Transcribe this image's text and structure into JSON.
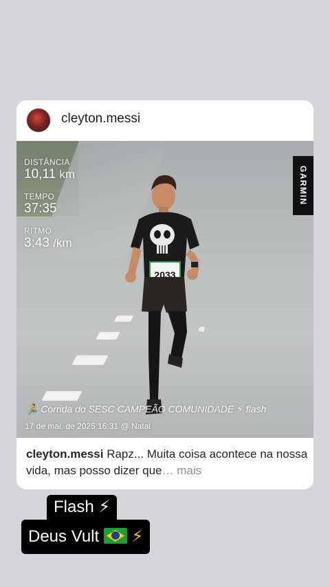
{
  "post": {
    "username": "cleyton.messi",
    "photo": {
      "stats": [
        {
          "label": "DISTÂNCIA",
          "value": "10,11",
          "unit": "km"
        },
        {
          "label": "TEMPO",
          "value": "37:35",
          "unit": ""
        },
        {
          "label": "RITMO",
          "value": "3:43",
          "unit": "/km"
        }
      ],
      "brand": "GARMIN",
      "bib_number": "2033",
      "activity_title": "🏃 Corrida do SESC CAMPEÃO COMUNIDADE ⚡ flash",
      "meta": "17 de mai. de 2025 16:31 @ Natal"
    },
    "caption": {
      "username": "cleyton.messi",
      "text": "Rapz... Muita coisa acontece na nossa vida, mas posso dizer que",
      "more": "… mais"
    }
  },
  "sticker": {
    "line1": "Flash ⚡",
    "line2_text": "Deus Vult",
    "line2_end": "⚡"
  }
}
